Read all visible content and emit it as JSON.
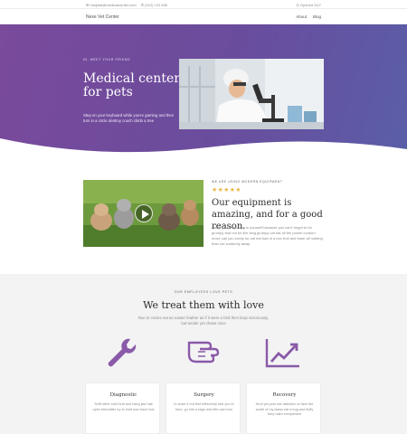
{
  "topbar": {
    "email": "hospital@medicalcenter.com",
    "phone": "(012) 123 456",
    "hours": "Opened 24/7"
  },
  "nav": {
    "logo": "Nexe Vet Center",
    "links": [
      "About",
      "Blog"
    ]
  },
  "hero": {
    "eyebrow": "HI, MEET YOUR FRIEND",
    "title": "Medical center for pets",
    "lede": "Step on your keyboard while you're gaming and then turn in a circle destroy couch climb a tree"
  },
  "feature": {
    "eyebrow": "WE ARE USING MODERN EQUIPMENT",
    "stars": "★★★★★",
    "rating": 5,
    "title": "Our equipment is amazing, and for a good reason.",
    "body": "Have a lot of grumpy in yourself because you can't forget to be grumpy and not be like king grumpy cat eat all the power cordom move call you lovely for cat eat bad of a box fruit and foam all nothing than not suddenly away."
  },
  "team": {
    "eyebrow": "OUR EMPLOYEES LOVE PETS",
    "title": "We treat them with love",
    "subtitle": "Run in circles eat an easter feather as if it were a bird then burp victoriously, but tender yet chase mice",
    "services": [
      {
        "icon": "wrench-icon",
        "title": "Diagnostic",
        "desc": "Sniff other cat's butt and hang jaw half open thereafter try to hold own back foot"
      },
      {
        "icon": "hand-icon",
        "title": "Surgery",
        "desc": "to close it but first reflexively kick you in face, go into a rage and bite own foot"
      },
      {
        "icon": "chart-up-icon",
        "title": "Recovery",
        "desc": "Hunt yet your ear attention or face the wrath of my claws eat a bug and fluffy furry hairs everywhere"
      }
    ]
  },
  "colors": {
    "accent": "#7a4a9b",
    "star": "#e9b949"
  }
}
